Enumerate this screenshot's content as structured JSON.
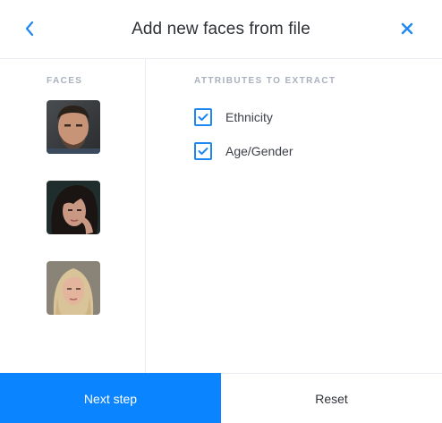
{
  "header": {
    "title": "Add new faces from file",
    "back_icon": "chevron-left-icon",
    "close_icon": "close-icon",
    "accent_color": "#1e88f0"
  },
  "faces_section": {
    "label": "FACES",
    "faces": [
      {
        "name": "face-man-bearded"
      },
      {
        "name": "face-woman-dark-hair"
      },
      {
        "name": "face-woman-blonde"
      }
    ]
  },
  "attributes_section": {
    "label": "ATTRIBUTES TO EXTRACT",
    "items": [
      {
        "label": "Ethnicity",
        "checked": true
      },
      {
        "label": "Age/Gender",
        "checked": true
      }
    ]
  },
  "footer": {
    "next_label": "Next step",
    "reset_label": "Reset",
    "primary_color": "#0a84ff"
  }
}
